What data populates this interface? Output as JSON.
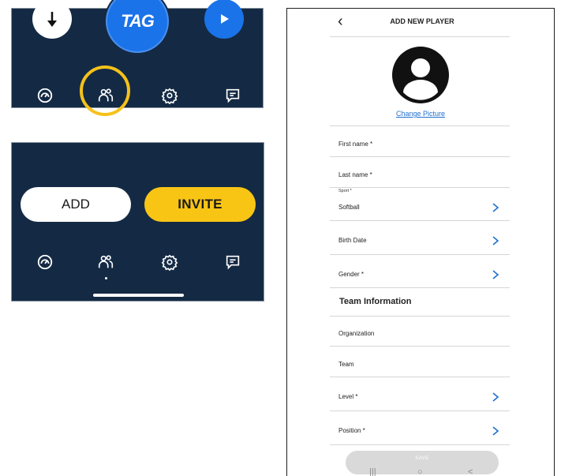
{
  "panel_top": {
    "tag_label": "TAG",
    "nav": [
      "dashboard-icon",
      "users-icon",
      "gear-icon",
      "chat-icon"
    ]
  },
  "panel_bottom": {
    "add_label": "ADD",
    "invite_label": "INVITE"
  },
  "colors": {
    "navy": "#142a44",
    "blue": "#1a73e8",
    "yellow": "#f8c515",
    "link": "#1f6fd1"
  },
  "form": {
    "title": "ADD NEW PLAYER",
    "change_picture": "Change Picture",
    "first_name": "First name *",
    "last_name": "Last name *",
    "sport_label": "Sport *",
    "sport_value": "Softball",
    "birth_date": "Birth Date",
    "gender": "Gender *",
    "section": "Team Information",
    "organization": "Organization",
    "team": "Team",
    "level": "Level *",
    "position": "Position *",
    "save": "SAVE"
  },
  "system_nav": {
    "recents": "|||",
    "home": "○",
    "back": "<"
  }
}
